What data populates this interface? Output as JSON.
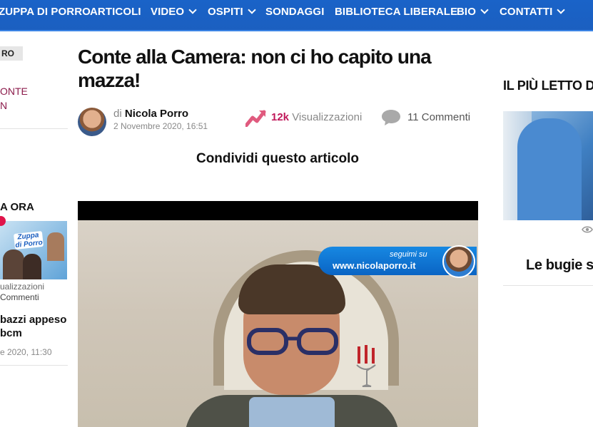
{
  "nav": {
    "items": [
      {
        "label": "ZUPPA DI PORRO",
        "dropdown": false
      },
      {
        "label": "ARTICOLI",
        "dropdown": false
      },
      {
        "label": "VIDEO",
        "dropdown": true
      },
      {
        "label": "OSPITI",
        "dropdown": true
      },
      {
        "label": "SONDAGGI",
        "dropdown": false
      },
      {
        "label": "BIBLIOTECA LIBERALE",
        "dropdown": false
      },
      {
        "label": "BIO",
        "dropdown": true
      },
      {
        "label": "CONTATTI",
        "dropdown": true
      }
    ]
  },
  "left_sidebar": {
    "badge": "RO",
    "link_line1": "ONTE",
    "link_line2": "N",
    "section_heading": "A ORA",
    "thumb_text": "Zuppa di Porro",
    "views": "ualizzazioni",
    "comments": "Commenti",
    "article_title": "bazzi appeso bcm",
    "article_date": "e 2020, 11:30"
  },
  "article": {
    "title": "Conte alla Camera: non ci ho capito una mazza!",
    "author_prefix": "di",
    "author": "Nicola Porro",
    "date": "2 Novembre 2020, 16:51",
    "views_count": "12k",
    "views_label": "Visualizzazioni",
    "comments": "11 Commenti",
    "share_heading": "Condividi questo articolo"
  },
  "video": {
    "banner_small": "seguimi su",
    "banner_url": "www.nicolaporro.it"
  },
  "right_sidebar": {
    "heading": "IL PIÙ LETTO D",
    "article_title": "Le bugie s"
  },
  "colors": {
    "nav_bg": "#1a63c8",
    "accent": "#c0185a",
    "link": "#8b1a4a"
  }
}
